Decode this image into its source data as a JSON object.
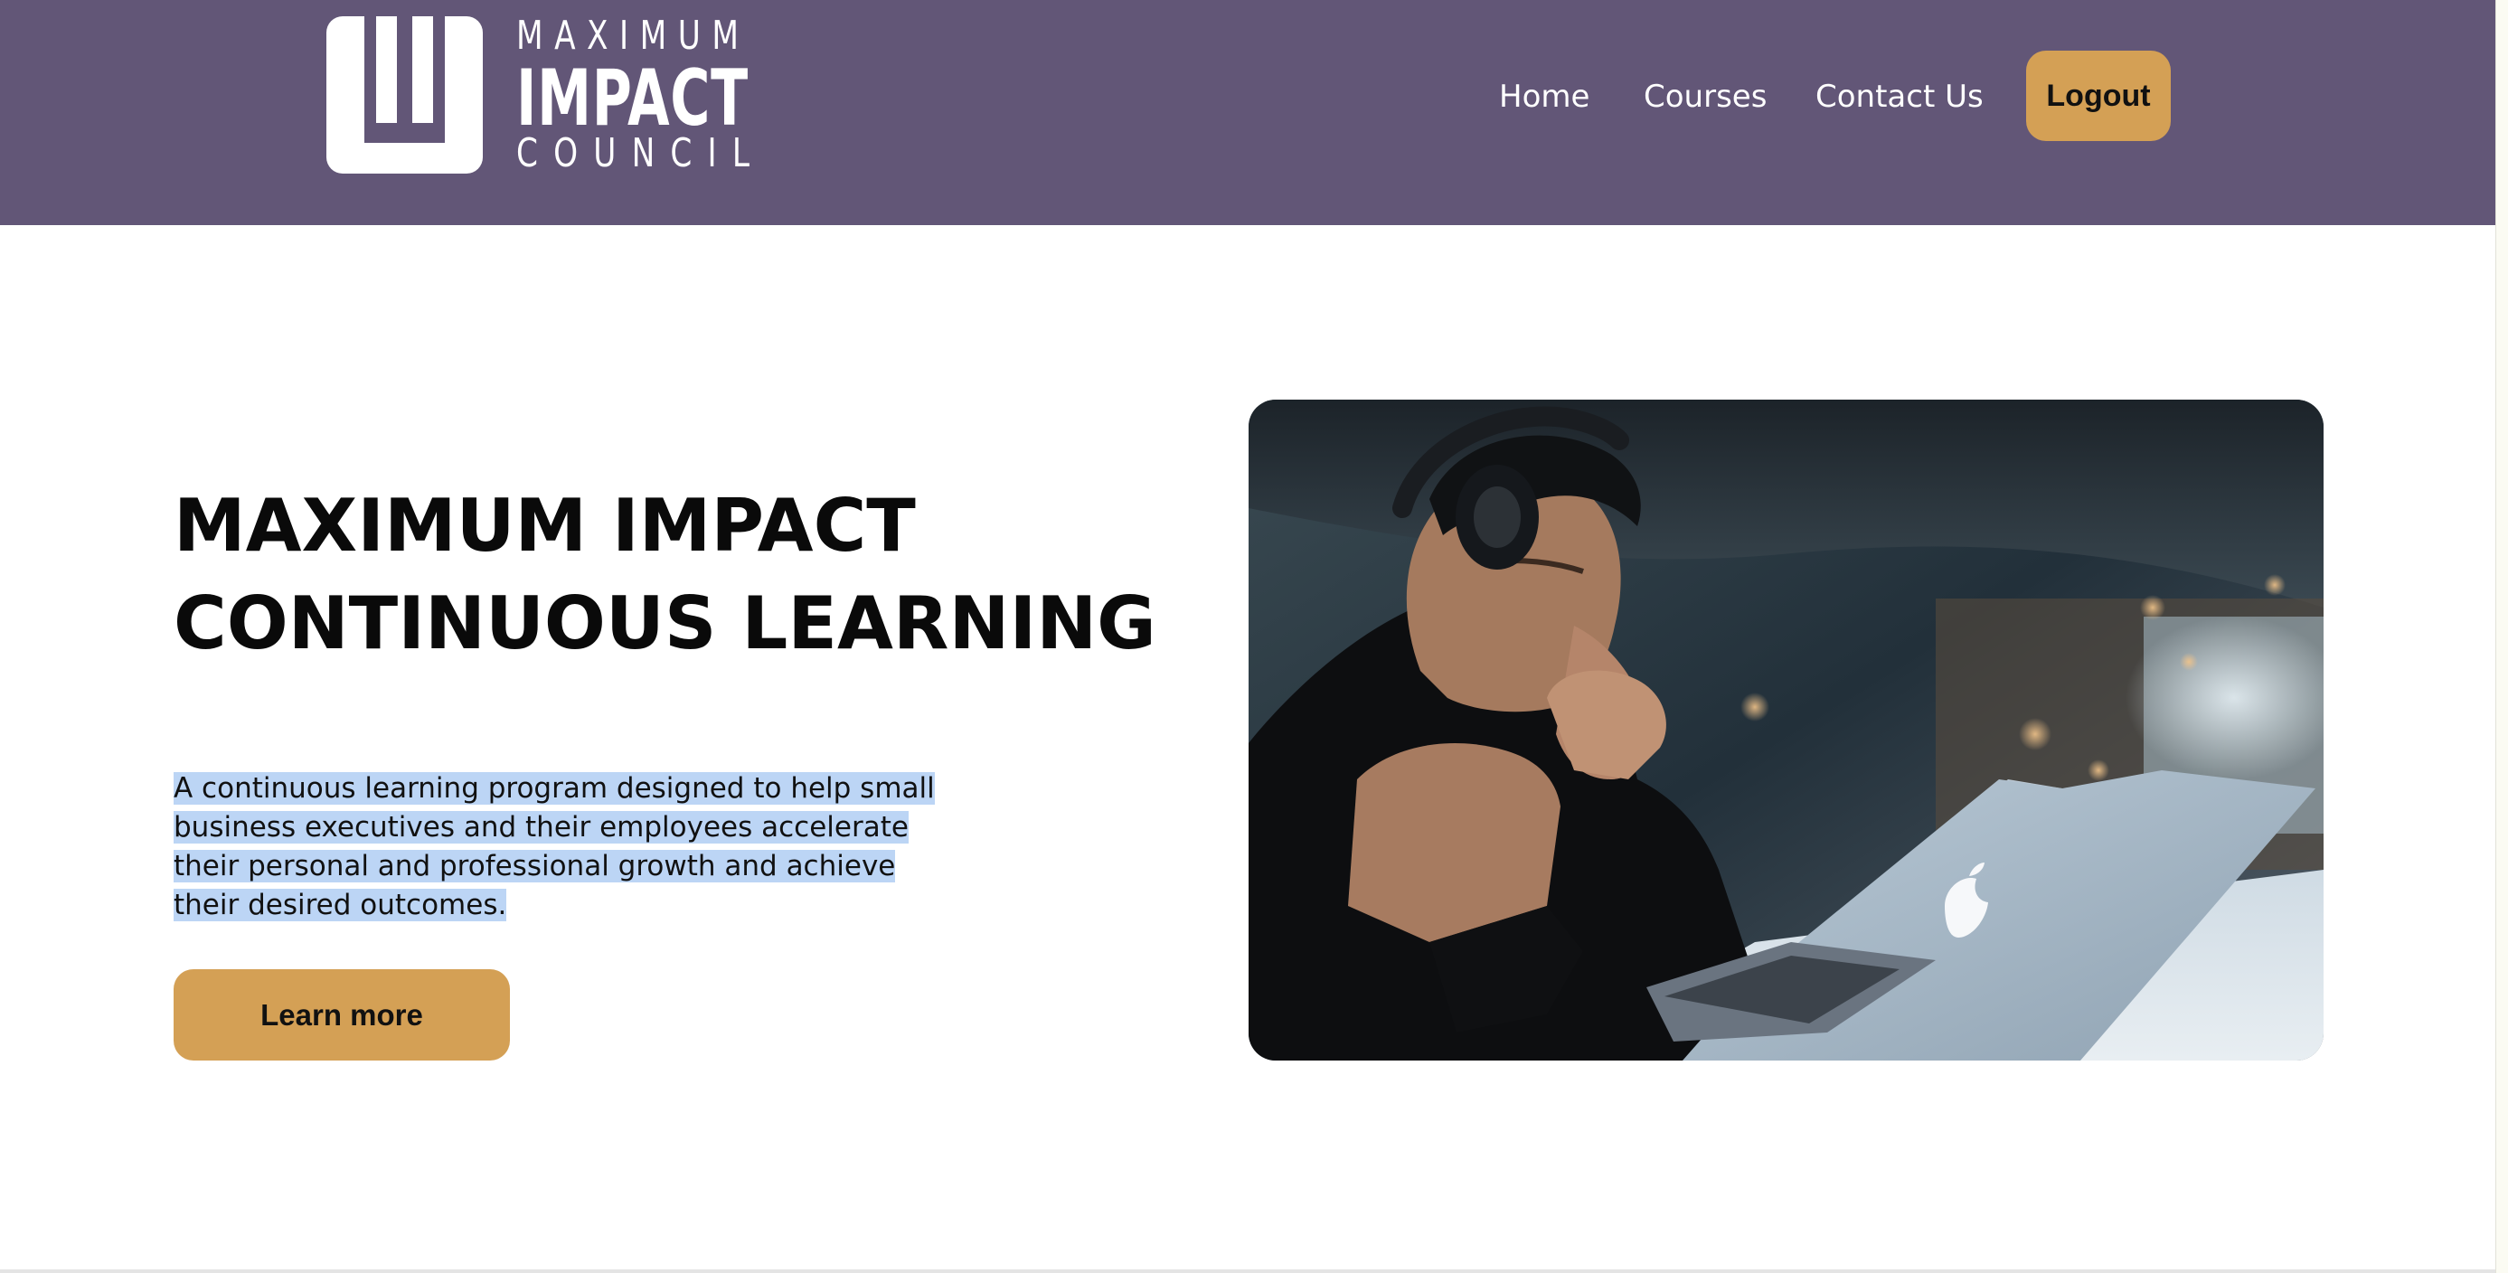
{
  "brand": {
    "line1": "MAXIMUM",
    "line2": "IMPACT",
    "line3": "COUNCIL",
    "logo_icon": "mic-logo-mark"
  },
  "nav": {
    "items": [
      {
        "label": "Home"
      },
      {
        "label": "Courses"
      },
      {
        "label": "Contact Us"
      }
    ],
    "logout_label": "Logout"
  },
  "hero": {
    "title_line1": "MAXIMUM IMPACT",
    "title_line2": "CONTINUOUS LEARNING",
    "description": "A continuous learning program designed to help small business executives and their employees accelerate their personal and professional growth and achieve their desired outcomes.",
    "cta_label": "Learn more",
    "image_alt": "Man wearing headphones looking at a laptop"
  },
  "colors": {
    "header_bg": "#625677",
    "button_bg": "#d4a055",
    "selection_highlight": "#bcd5f5"
  }
}
